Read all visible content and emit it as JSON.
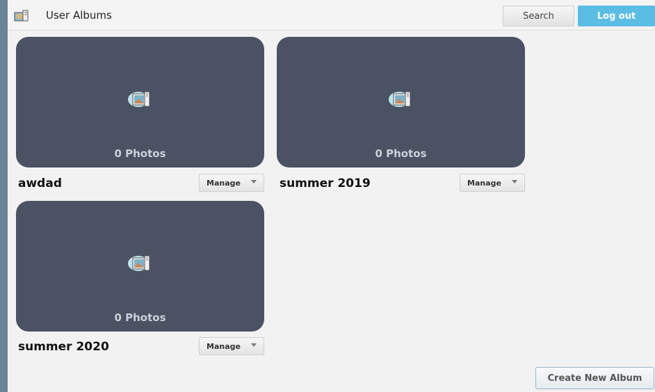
{
  "app": {
    "title": "User Albums",
    "icon": "photo-album-icon"
  },
  "header": {
    "search_label": "Search",
    "logout_label": "Log out",
    "logout_color": "#5bbde4"
  },
  "albums": [
    {
      "name": "awdad",
      "photo_count": "0 Photos",
      "manage_label": "Manage"
    },
    {
      "name": "summer 2019",
      "photo_count": "0 Photos",
      "manage_label": "Manage"
    },
    {
      "name": "summer 2020",
      "photo_count": "0 Photos",
      "manage_label": "Manage"
    }
  ],
  "footer": {
    "create_label": "Create New Album"
  },
  "colors": {
    "thumbnail_bg": "#4a5263",
    "window_bg": "#f2f2f2"
  }
}
